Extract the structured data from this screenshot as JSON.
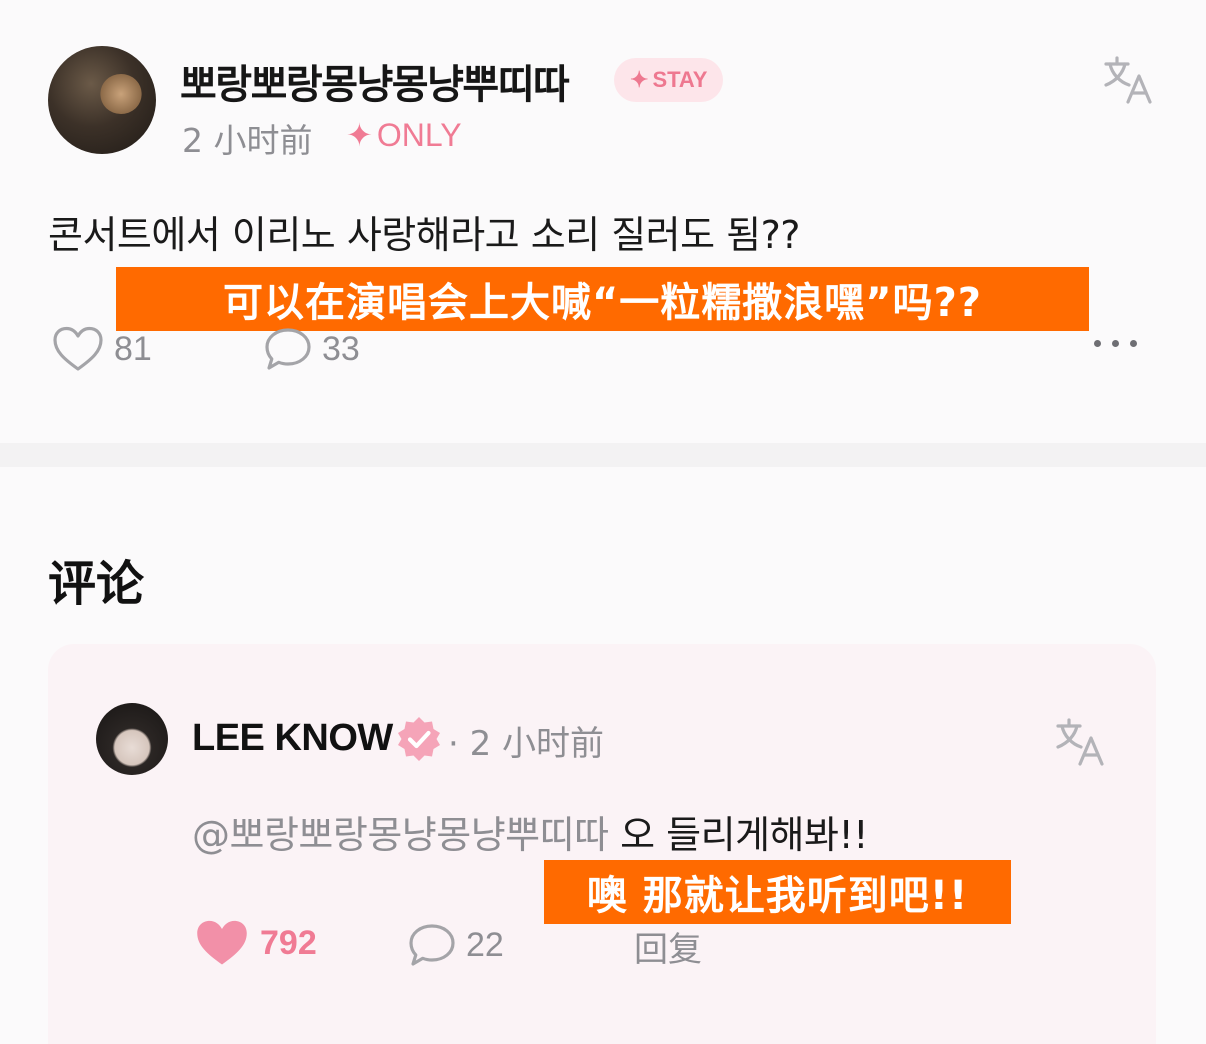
{
  "post": {
    "username": "뽀랑뽀랑몽냥몽냥뿌띠따",
    "badge": "STAY",
    "time": "2 小时前",
    "only_label": "ONLY",
    "text": "콘서트에서 이리노 사랑해라고 소리 질러도 됨??",
    "caption": "可以在演唱会上大喊“一粒糯撒浪嘿”吗??",
    "likes": "81",
    "comments": "33"
  },
  "comments_section": {
    "heading": "评论",
    "comment": {
      "author": "LEE KNOW",
      "time": "· 2 小时前",
      "mention": "@뽀랑뽀랑몽냥몽냥뿌띠따",
      "text": " 오 들리게해봐!!",
      "caption": "噢 那就让我听到吧!!",
      "likes": "792",
      "replies_count": "22",
      "reply_label": "回复"
    }
  },
  "colors": {
    "accent_pink": "#f07b94",
    "caption_orange": "#ff6a00",
    "muted_gray": "#8e8e93"
  },
  "icons": [
    "translate-icon",
    "heart-icon",
    "comment-icon",
    "more-icon",
    "verified-icon",
    "sparkle-icon"
  ]
}
